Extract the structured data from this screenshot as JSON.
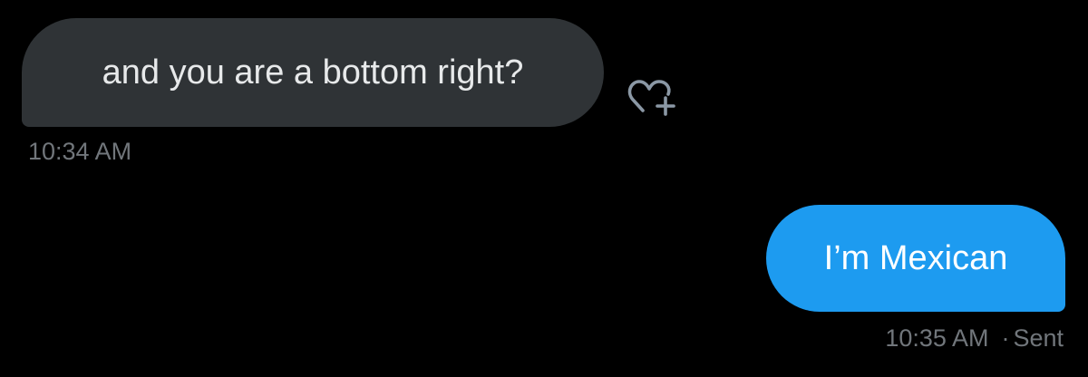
{
  "messages": [
    {
      "direction": "received",
      "text": "and you are a bottom right?",
      "time": "10:34 AM"
    },
    {
      "direction": "sent",
      "text": "I’m Mexican",
      "time": "10:35 AM",
      "status": "Sent"
    }
  ],
  "meta_separator": "·",
  "icons": {
    "react": "heart-plus-icon"
  },
  "colors": {
    "background": "#000000",
    "received_bubble": "#2f3336",
    "sent_bubble": "#1d9bf0",
    "meta_text": "#71767b"
  }
}
